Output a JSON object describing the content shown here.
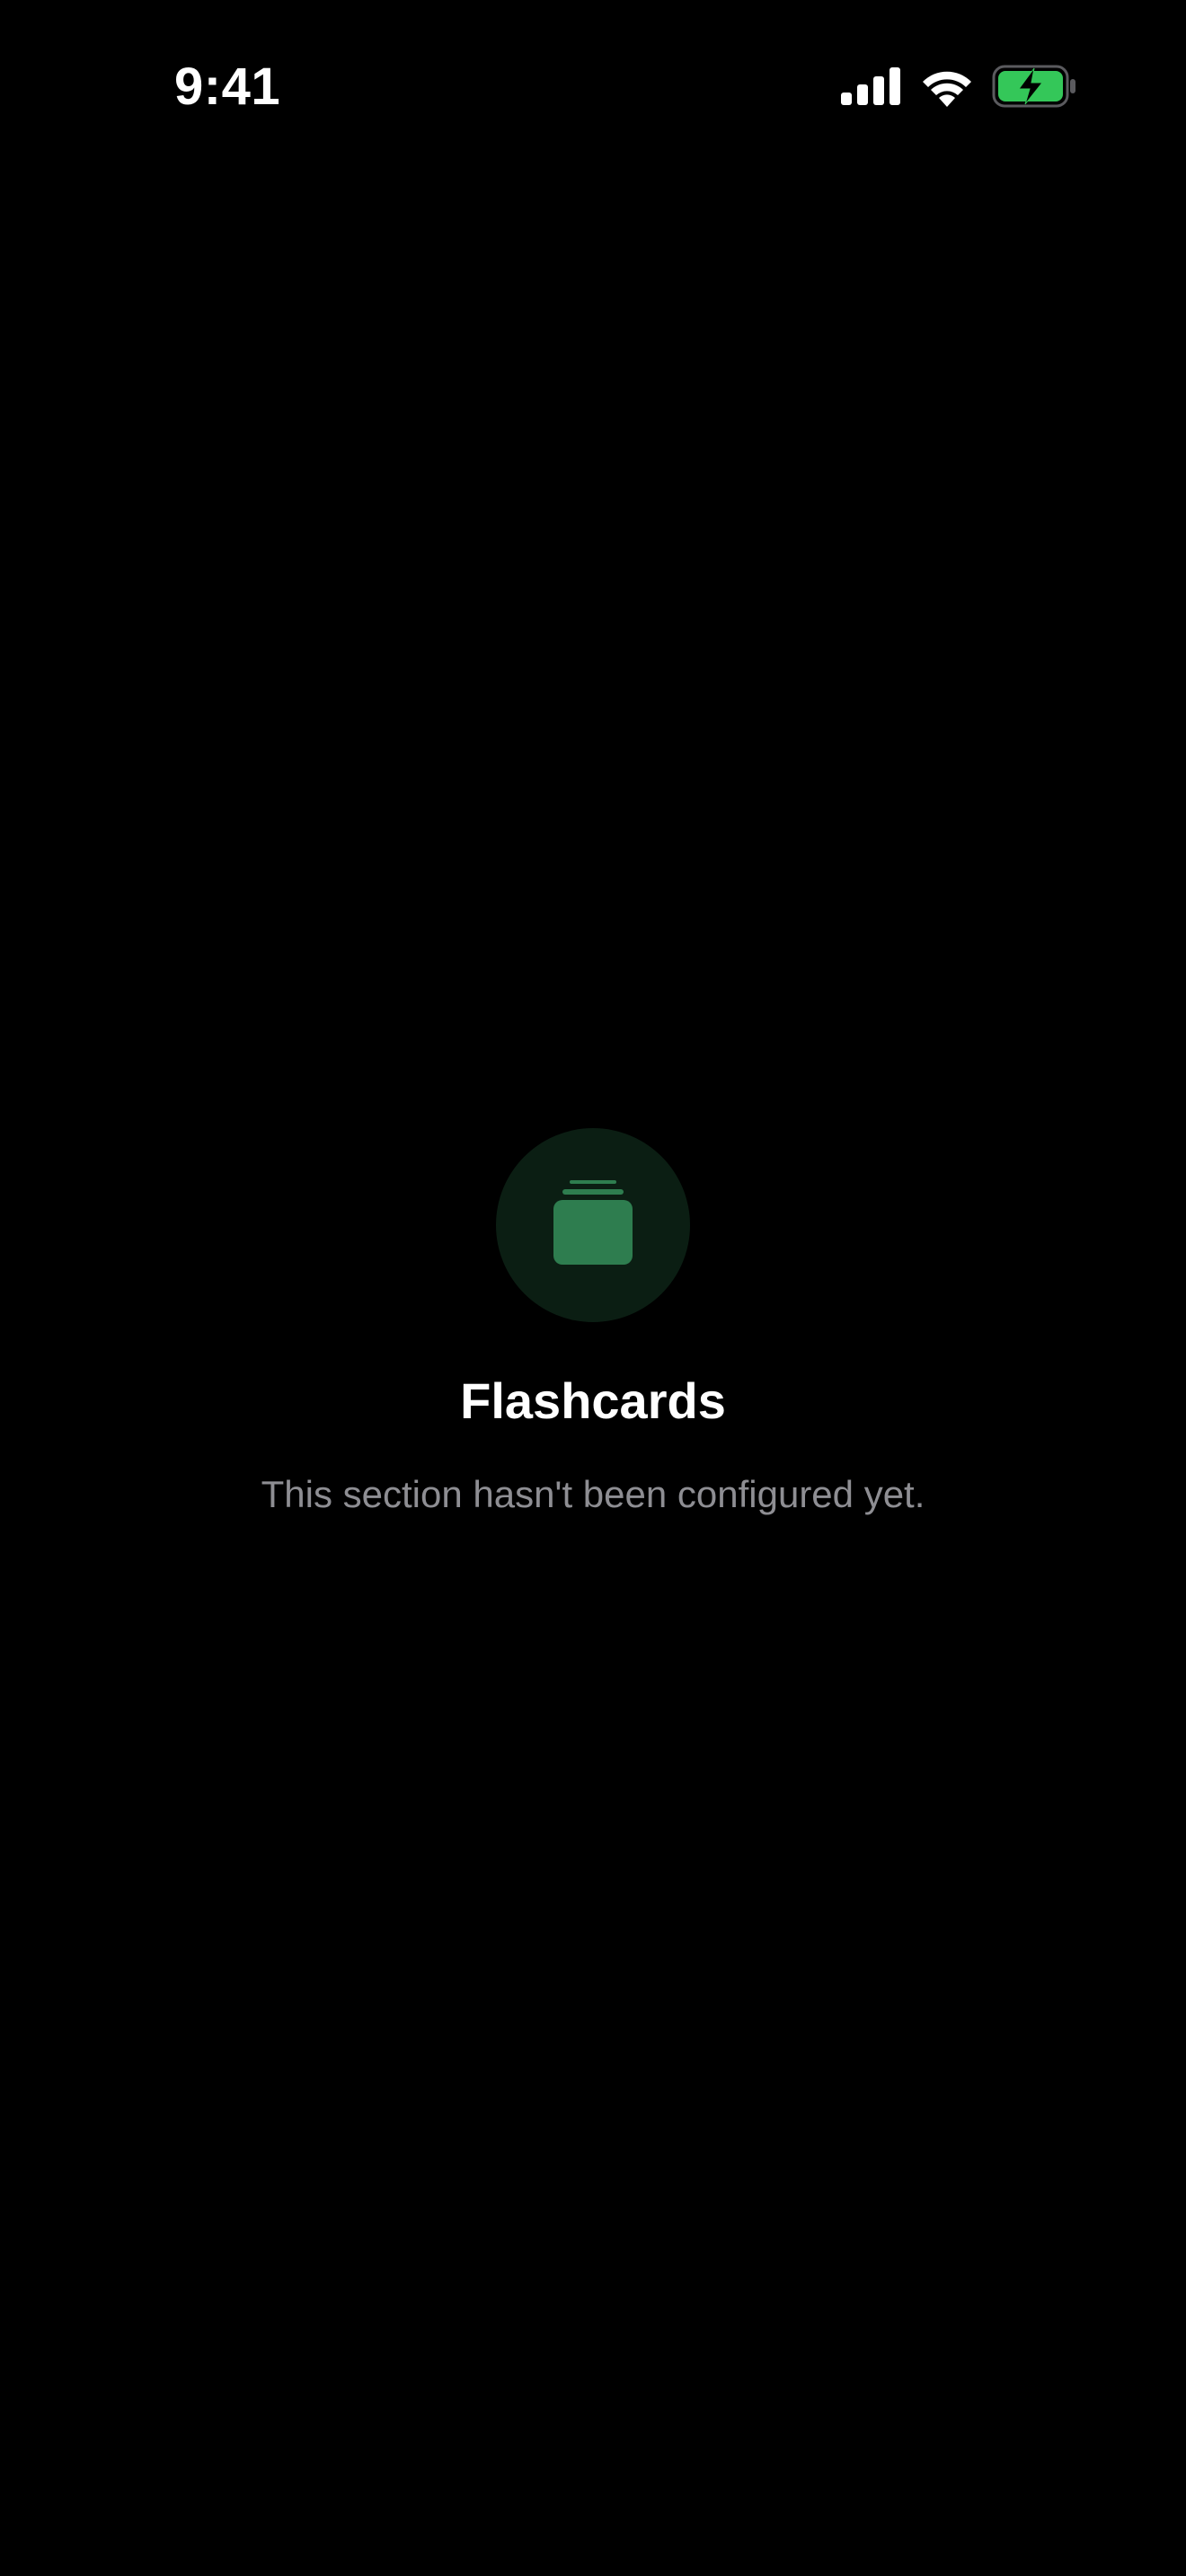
{
  "status_bar": {
    "time": "9:41",
    "icons": [
      "signal-icon",
      "wifi-icon",
      "battery-charging-icon"
    ]
  },
  "empty_state": {
    "icon": "flashcards-stack-icon",
    "title": "Flashcards",
    "subtitle": "This section hasn't been configured yet."
  },
  "colors": {
    "background": "#000000",
    "accent": "#2e7d4f",
    "accent_circle": "#0b1e13",
    "battery_fill": "#34c759",
    "title": "#ffffff",
    "subtitle": "#8e8e93"
  }
}
